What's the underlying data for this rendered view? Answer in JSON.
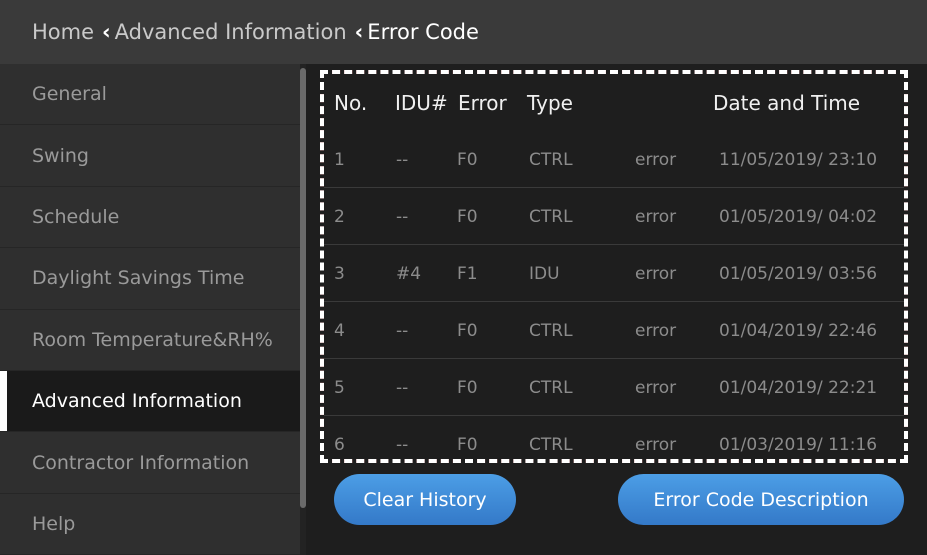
{
  "breadcrumb": {
    "home": "Home",
    "parent": "Advanced Information",
    "current": "Error Code"
  },
  "sidebar": {
    "items": [
      {
        "label": "General"
      },
      {
        "label": "Swing"
      },
      {
        "label": "Schedule"
      },
      {
        "label": "Daylight Savings Time"
      },
      {
        "label": "Room Temperature&RH%"
      },
      {
        "label": "Advanced Information",
        "active": true
      },
      {
        "label": "Contractor Information"
      },
      {
        "label": "Help"
      }
    ]
  },
  "table": {
    "headers": {
      "no": "No.",
      "idu": "IDU#",
      "error": "Error",
      "type": "Type",
      "datetime": "Date and Time"
    },
    "rows": [
      {
        "no": "1",
        "idu": "--",
        "error": "F0",
        "type": "CTRL",
        "status": "error",
        "datetime": "11/05/2019/ 23:10"
      },
      {
        "no": "2",
        "idu": "--",
        "error": "F0",
        "type": "CTRL",
        "status": "error",
        "datetime": "01/05/2019/ 04:02"
      },
      {
        "no": "3",
        "idu": "#4",
        "error": "F1",
        "type": "IDU",
        "status": "error",
        "datetime": "01/05/2019/ 03:56"
      },
      {
        "no": "4",
        "idu": "--",
        "error": "F0",
        "type": "CTRL",
        "status": "error",
        "datetime": "01/04/2019/ 22:46"
      },
      {
        "no": "5",
        "idu": "--",
        "error": "F0",
        "type": "CTRL",
        "status": "error",
        "datetime": "01/04/2019/ 22:21"
      },
      {
        "no": "6",
        "idu": "--",
        "error": "F0",
        "type": "CTRL",
        "status": "error",
        "datetime": "01/03/2019/ 11:16"
      }
    ]
  },
  "buttons": {
    "clear_history": "Clear History",
    "error_code_description": "Error Code Description"
  },
  "colors": {
    "accent_button": "#3f8bd8",
    "highlight_dash_red": "#c0262b",
    "highlight_dash_white": "#ffffff"
  }
}
